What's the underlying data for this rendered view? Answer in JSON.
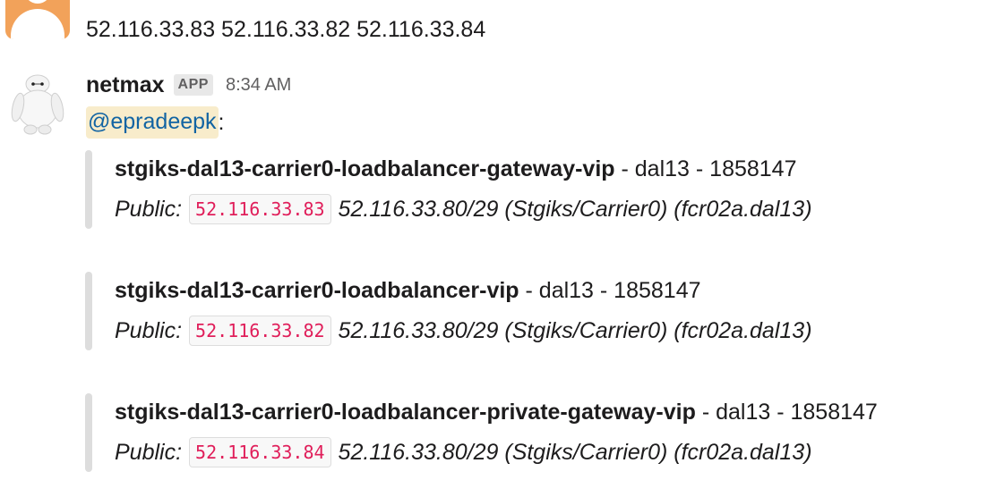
{
  "previous_message": {
    "avatar_icon": "user-silhouette-icon",
    "text": "52.116.33.83 52.116.33.82 52.116.33.84"
  },
  "message": {
    "avatar_icon": "white-robot-avatar-icon",
    "sender": "netmax",
    "badge": "APP",
    "time": "8:34 AM",
    "mention": "@epradeepk",
    "mention_suffix": ":",
    "attachments": [
      {
        "name": "stgiks-dal13-carrier0-loadbalancer-gateway-vip",
        "meta": " - dal13 - 1858147",
        "public_label": "Public:",
        "ip": "52.116.33.83",
        "details": "52.116.33.80/29 (Stgiks/Carrier0) (fcr02a.dal13)"
      },
      {
        "name": "stgiks-dal13-carrier0-loadbalancer-vip",
        "meta": " - dal13 - 1858147",
        "public_label": "Public:",
        "ip": "52.116.33.82",
        "details": "52.116.33.80/29 (Stgiks/Carrier0) (fcr02a.dal13)"
      },
      {
        "name": "stgiks-dal13-carrier0-loadbalancer-private-gateway-vip",
        "meta": " - dal13 - 1858147",
        "public_label": "Public:",
        "ip": "52.116.33.84",
        "details": "52.116.33.80/29 (Stgiks/Carrier0) (fcr02a.dal13)"
      }
    ]
  },
  "colors": {
    "mention_bg": "#f8eccb",
    "mention_text": "#1264a3",
    "code_text": "#e01e5a",
    "attachment_bar": "#dddddd",
    "avatar_orange": "#f2a25a"
  }
}
